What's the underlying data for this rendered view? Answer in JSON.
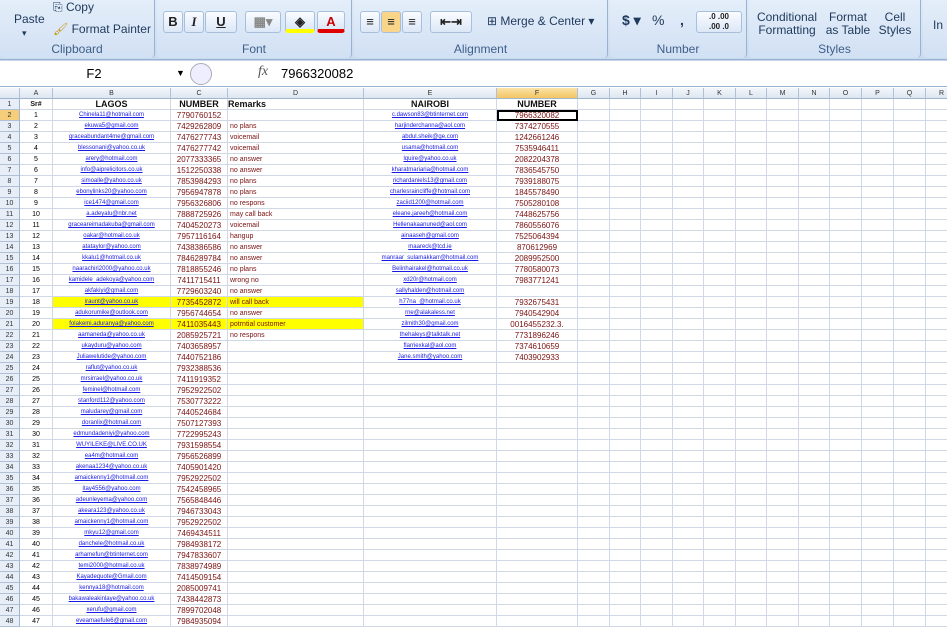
{
  "ribbon": {
    "clipboard": {
      "label": "Clipboard",
      "paste": "Paste",
      "copy": "Copy",
      "format_painter": "Format Painter"
    },
    "font": {
      "label": "Font",
      "bold": "B",
      "italic": "I",
      "underline": "U",
      "font_color": "A"
    },
    "alignment": {
      "label": "Alignment",
      "merge_center": "Merge & Center"
    },
    "number": {
      "label": "Number",
      "currency": "$",
      "percent": "%",
      "comma": ",",
      "inc_decimal": ".0 .00",
      "dec_decimal": ".00 .0"
    },
    "styles": {
      "label": "Styles",
      "conditional": "Conditional Formatting",
      "format_table": "Format as Table",
      "cell_styles": "Cell Styles"
    },
    "insert": "In"
  },
  "formula_bar": {
    "name_box": "F2",
    "fx": "fx",
    "value": "7966320082"
  },
  "columns": [
    "A",
    "B",
    "C",
    "D",
    "E",
    "F",
    "G",
    "H",
    "I",
    "J",
    "K",
    "L",
    "M",
    "N",
    "O",
    "P",
    "Q",
    "R"
  ],
  "selected_cell": {
    "column": "F",
    "row": 2
  },
  "colors": {
    "highlight": "#ffff00",
    "link": "#1a1ae6",
    "number": "#7a1010"
  },
  "header_row": {
    "a": "Sr#",
    "b": "LAGOS",
    "c": "NUMBER",
    "d": "Remarks",
    "e": "NAIROBI",
    "f": "NUMBER"
  },
  "rows": [
    {
      "a": "1",
      "b": "Chinela11@hotmail.com",
      "c": "7790760152",
      "d": "",
      "e": "c.dawson83@btinternet.com",
      "f": "7966320082"
    },
    {
      "a": "2",
      "b": "ekuwa5@gmail.com",
      "c": "7429262809",
      "d": "no plans",
      "e": "harjinderchanna@aol.com",
      "f": "7374270555"
    },
    {
      "a": "3",
      "b": "graceabundant4me@gmail.com",
      "c": "7476277743",
      "d": "voicemail",
      "e": "abdul.sheik@ge.com",
      "f": "1242661246"
    },
    {
      "a": "4",
      "b": "blessonani@yahoo.co.uk",
      "c": "7476277742",
      "d": "voicemail",
      "e": "usama@hotmail.com",
      "f": "7535946411"
    },
    {
      "a": "5",
      "b": "arery@hotmail.com",
      "c": "2077333365",
      "d": "no answer",
      "e": "lquire@yahoo.co.uk",
      "f": "2082204378"
    },
    {
      "a": "6",
      "b": "info@aiprelicitors.co.uk",
      "c": "1512250338",
      "d": "no answer",
      "e": "kharatmariaria@hotmail.com",
      "f": "7836545750"
    },
    {
      "a": "7",
      "b": "simoalle@yahoo.co.uk",
      "c": "7853984293",
      "d": "no plans",
      "e": "richardaniels13@gmail.com",
      "f": "7939188075"
    },
    {
      "a": "8",
      "b": "ebonylinks20@yahoo.com",
      "c": "7956947878",
      "d": "no plans",
      "e": "charlesraincliffe@hotmail.com",
      "f": "1845578490"
    },
    {
      "a": "9",
      "b": "ice1474@gmail.com",
      "c": "7956326806",
      "d": "no respons",
      "e": "zaciid1200@hotmail.com",
      "f": "7505280108"
    },
    {
      "a": "10",
      "b": "a.adeyalu@nbr.net",
      "c": "7888725926",
      "d": "may call back",
      "e": "eleane.jareeh@hotmail.com",
      "f": "7448625756"
    },
    {
      "a": "11",
      "b": "graceareimadakuba@gmail.com",
      "c": "7404520273",
      "d": "voicemail",
      "e": "Hellenakaanuned@aol.com",
      "f": "7860556076"
    },
    {
      "a": "12",
      "b": "oakar@hotmail.co.uk",
      "c": "7957116164",
      "d": "hangup",
      "e": "ainaaseh@gmail.com",
      "f": "7525064394"
    },
    {
      "a": "13",
      "b": "atataylor@yahoo.com",
      "c": "7438386586",
      "d": "no answer",
      "e": "maareck@tcd.ie",
      "f": "870612969"
    },
    {
      "a": "14",
      "b": "kkalu1@hotmail.co.uk",
      "c": "7846289784",
      "d": "no answer",
      "e": "manraar_sulamakkarr@hotmail.com",
      "f": "2089952500"
    },
    {
      "a": "15",
      "b": "naarachiri2000@yahoo.co.uk",
      "c": "7818855246",
      "d": "no plans",
      "e": "Belinhairakel@hotmail.co.uk",
      "f": "7780580073"
    },
    {
      "a": "16",
      "b": "kamidele_adekoya@yahoo.com",
      "c": "7411715411",
      "d": "wrong no",
      "e": "xd20r@hotmail.com",
      "f": "7983771241"
    },
    {
      "a": "17",
      "b": "akfakiyi@gmail.com",
      "c": "7729603240",
      "d": "no answer",
      "e": "sallyhalden@hotmail.com",
      "f": ""
    },
    {
      "a": "18",
      "b": "iraunt@yahoo.co.uk",
      "c": "7735452872",
      "d": "will call back",
      "e": "h77na_@hotmail.co.uk",
      "f": "7932675431",
      "hl": true
    },
    {
      "a": "19",
      "b": "adukorumike@outlook.com",
      "c": "7956744654",
      "d": "no answer",
      "e": "rne@alakaless.net",
      "f": "7940542904"
    },
    {
      "a": "20",
      "b": "folakemi.aduranya@yahoo.com",
      "c": "7411035443",
      "d": "potrntial customer",
      "e": "zilmith30@gmail.com",
      "f": "0016455232.3.",
      "hl": true
    },
    {
      "a": "21",
      "b": "aamaneda@yahoo.co.uk",
      "c": "2085925721",
      "d": "no respons",
      "e": "thehaleys@talktalk.net",
      "f": "7731896246"
    },
    {
      "a": "22",
      "b": "ukayduru@yahoo.com",
      "c": "7403658957",
      "d": "",
      "e": "flarriexkal@aol.com",
      "f": "7374610659"
    },
    {
      "a": "23",
      "b": "Juliawelutide@yahoo.com",
      "c": "7440752186",
      "d": "",
      "e": "Jane.smith@yahoo.com",
      "f": "7403902933"
    },
    {
      "a": "24",
      "b": "raflut@yahoo.co.uk",
      "c": "7932388536",
      "d": "",
      "e": "",
      "f": ""
    },
    {
      "a": "25",
      "b": "mrsirrael@yahoo.co.uk",
      "c": "7411919352",
      "d": "",
      "e": "",
      "f": ""
    },
    {
      "a": "26",
      "b": "feminel@hotmail.com",
      "c": "7952922502",
      "d": "",
      "e": "",
      "f": ""
    },
    {
      "a": "27",
      "b": "stanford112@yahoo.com",
      "c": "7530773222",
      "d": "",
      "e": "",
      "f": ""
    },
    {
      "a": "28",
      "b": "maludarey@gmail.com",
      "c": "7440524684",
      "d": "",
      "e": "",
      "f": ""
    },
    {
      "a": "29",
      "b": "doranlix@hotmail.com",
      "c": "7507127393",
      "d": "",
      "e": "",
      "f": ""
    },
    {
      "a": "30",
      "b": "edmundadeniyi@yahoo.com",
      "c": "7722995243",
      "d": "",
      "e": "",
      "f": ""
    },
    {
      "a": "31",
      "b": "WUYILEKE@LIVE.CO.UK",
      "c": "7931598554",
      "d": "",
      "e": "",
      "f": ""
    },
    {
      "a": "32",
      "b": "ea4m@hotmail.com",
      "c": "7956526899",
      "d": "",
      "e": "",
      "f": ""
    },
    {
      "a": "33",
      "b": "akenaa1234@yahoo.co.uk",
      "c": "7405901420",
      "d": "",
      "e": "",
      "f": ""
    },
    {
      "a": "34",
      "b": "amaickenny1@hotmail.com",
      "c": "7952922502",
      "d": "",
      "e": "",
      "f": ""
    },
    {
      "a": "35",
      "b": "itay4556@yahoo.com",
      "c": "7542458965",
      "d": "",
      "e": "",
      "f": ""
    },
    {
      "a": "36",
      "b": "adeunleyema@yahoo.com",
      "c": "7565848446",
      "d": "",
      "e": "",
      "f": ""
    },
    {
      "a": "37",
      "b": "akeara123@yahoo.co.uk",
      "c": "7946733043",
      "d": "",
      "e": "",
      "f": ""
    },
    {
      "a": "38",
      "b": "amaickenny1@hotmail.com",
      "c": "7952922502",
      "d": "",
      "e": "",
      "f": ""
    },
    {
      "a": "39",
      "b": "mkyu12@gmail.com",
      "c": "7469434511",
      "d": "",
      "e": "",
      "f": ""
    },
    {
      "a": "40",
      "b": "danchele@hotmail.co.uk",
      "c": "7984938172",
      "d": "",
      "e": "",
      "f": ""
    },
    {
      "a": "41",
      "b": "arhamefun@btinternet.com",
      "c": "7947833607",
      "d": "",
      "e": "",
      "f": ""
    },
    {
      "a": "42",
      "b": "temi2000@hotmail.co.uk",
      "c": "7838974989",
      "d": "",
      "e": "",
      "f": ""
    },
    {
      "a": "43",
      "b": "Kayadequote@Gmail.com",
      "c": "7414509154",
      "d": "",
      "e": "",
      "f": ""
    },
    {
      "a": "44",
      "b": "kennya18@hotmail.com",
      "c": "2085009741",
      "d": "",
      "e": "",
      "f": ""
    },
    {
      "a": "45",
      "b": "bakawaleakinlaye@yahoo.co.uk",
      "c": "7438442873",
      "d": "",
      "e": "",
      "f": ""
    },
    {
      "a": "46",
      "b": "xerufu@gmail.com",
      "c": "7899702048",
      "d": "",
      "e": "",
      "f": ""
    },
    {
      "a": "47",
      "b": "eveamaefule6@gmail.com",
      "c": "7984935094",
      "d": "",
      "e": "",
      "f": ""
    }
  ]
}
